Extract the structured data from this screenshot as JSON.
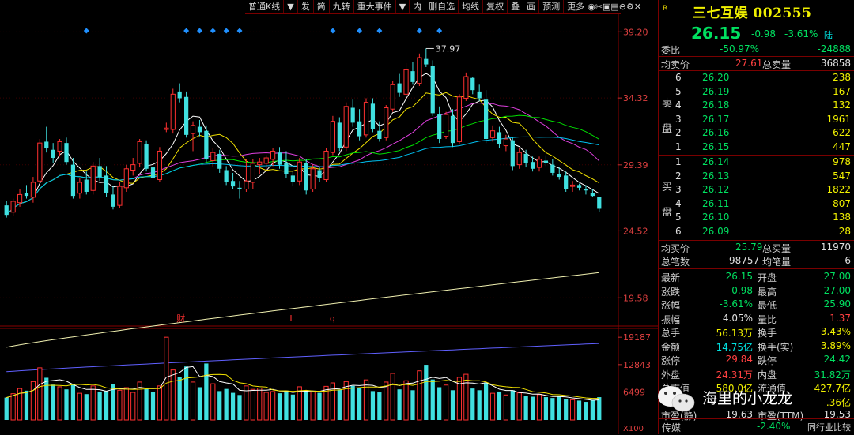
{
  "toolbar": {
    "items": [
      "普通K线",
      "▼",
      "发",
      "简",
      "九转",
      "重大事件",
      "▼",
      "内",
      "删自选",
      "均线",
      "复权",
      "叠",
      "画",
      "预测",
      "更多"
    ],
    "icons": [
      "eye-icon",
      "scissors-icon",
      "lock-icon",
      "box-icon",
      "zoom-out-icon",
      "settings-icon",
      "close-icon"
    ]
  },
  "main_axis": {
    "ticks": [
      "39.20",
      "34.32",
      "29.39",
      "24.52",
      "19.58"
    ],
    "peak_label": "37.97",
    "markers": [
      "财",
      "L",
      "q"
    ]
  },
  "volume_axis": {
    "ticks": [
      "19187",
      "12843",
      "6499"
    ],
    "unit": "X100"
  },
  "stock": {
    "marker": "R",
    "name": "三七互娱",
    "code": "002555",
    "price": "26.15",
    "change": "-0.98",
    "change_pct": "-3.61%",
    "board": "陆"
  },
  "quote": {
    "weibi_label": "委比",
    "weibi": "-50.97%",
    "weicha": "-24888",
    "avg_sell_label": "均卖价",
    "avg_sell": "27.61",
    "total_sell_label": "总卖量",
    "total_sell": "36858",
    "avg_buy_label": "均买价",
    "avg_buy": "25.79",
    "total_buy_label": "总买量",
    "total_buy": "11970",
    "total_trades_label": "总笔数",
    "total_trades": "98757",
    "avg_trade_label": "均笔量",
    "avg_trade": "6"
  },
  "sell_side_label": [
    "卖",
    "盘"
  ],
  "buy_side_label": [
    "买",
    "盘"
  ],
  "asks": [
    {
      "level": "6",
      "price": "26.20",
      "vol": "238"
    },
    {
      "level": "5",
      "price": "26.19",
      "vol": "167"
    },
    {
      "level": "4",
      "price": "26.18",
      "vol": "132"
    },
    {
      "level": "3",
      "price": "26.17",
      "vol": "1961"
    },
    {
      "level": "2",
      "price": "26.16",
      "vol": "622"
    },
    {
      "level": "1",
      "price": "26.15",
      "vol": "447"
    }
  ],
  "bids": [
    {
      "level": "1",
      "price": "26.14",
      "vol": "978"
    },
    {
      "level": "2",
      "price": "26.13",
      "vol": "547"
    },
    {
      "level": "3",
      "price": "26.12",
      "vol": "1822"
    },
    {
      "level": "4",
      "price": "26.11",
      "vol": "807"
    },
    {
      "level": "5",
      "price": "26.10",
      "vol": "138"
    },
    {
      "level": "6",
      "price": "26.09",
      "vol": "28"
    }
  ],
  "stats": [
    {
      "l1": "最新",
      "v1": "26.15",
      "c1": "grn",
      "l2": "开盘",
      "v2": "27.00",
      "c2": "grn"
    },
    {
      "l1": "涨跌",
      "v1": "-0.98",
      "c1": "grn",
      "l2": "最高",
      "v2": "27.00",
      "c2": "grn"
    },
    {
      "l1": "涨幅",
      "v1": "-3.61%",
      "c1": "grn",
      "l2": "最低",
      "v2": "25.90",
      "c2": "grn"
    },
    {
      "l1": "振幅",
      "v1": "4.05%",
      "c1": "wht",
      "l2": "量比",
      "v2": "1.37",
      "c2": "red"
    },
    {
      "l1": "总手",
      "v1": "56.13万",
      "c1": "yel",
      "l2": "换手",
      "v2": "3.43%",
      "c2": "yel"
    },
    {
      "l1": "金额",
      "v1": "14.75亿",
      "c1": "cyan",
      "l2": "换手(实)",
      "v2": "3.89%",
      "c2": "yel"
    },
    {
      "l1": "涨停",
      "v1": "29.84",
      "c1": "red",
      "l2": "跌停",
      "v2": "24.42",
      "c2": "grn"
    },
    {
      "l1": "外盘",
      "v1": "24.31万",
      "c1": "red",
      "l2": "内盘",
      "v2": "31.82万",
      "c2": "grn"
    },
    {
      "l1": "总市值",
      "v1": "580.0亿",
      "c1": "yel",
      "l2": "流通值",
      "v2": "427.7亿",
      "c2": "yel"
    },
    {
      "l1": "",
      "v1": "",
      "c1": "yel",
      "l2": "",
      "v2": ".36亿",
      "c2": "yel"
    },
    {
      "l1": "市盈(静)",
      "v1": "19.63",
      "c1": "wht",
      "l2": "市盈(TTM)",
      "v2": "19.53",
      "c2": "wht"
    }
  ],
  "bottom": {
    "sector": "传媒",
    "sector_pct": "-2.40%",
    "compare": "同行业比较"
  },
  "watermark": {
    "text": "海里的小龙龙"
  },
  "chart_data": {
    "type": "candlestick",
    "title": "",
    "ylim": [
      17.5,
      40.5
    ],
    "ma_colors": [
      "#ffffff",
      "#f0e000",
      "#e040e0",
      "#00e000",
      "#00c0f0",
      "#f0f0b0",
      "#6060ff"
    ],
    "candles": [
      {
        "o": 26.4,
        "h": 26.7,
        "l": 25.5,
        "c": 25.7
      },
      {
        "o": 25.9,
        "h": 26.9,
        "l": 25.6,
        "c": 26.7
      },
      {
        "o": 26.6,
        "h": 27.6,
        "l": 26.3,
        "c": 27.2
      },
      {
        "o": 27.3,
        "h": 27.9,
        "l": 26.9,
        "c": 27.1
      },
      {
        "o": 27.0,
        "h": 28.5,
        "l": 26.6,
        "c": 28.1
      },
      {
        "o": 28.2,
        "h": 31.3,
        "l": 28.0,
        "c": 31.0
      },
      {
        "o": 31.1,
        "h": 32.2,
        "l": 30.3,
        "c": 30.6
      },
      {
        "o": 30.5,
        "h": 31.0,
        "l": 29.5,
        "c": 29.9
      },
      {
        "o": 30.4,
        "h": 31.3,
        "l": 30.0,
        "c": 31.1
      },
      {
        "o": 31.0,
        "h": 31.4,
        "l": 29.4,
        "c": 29.6
      },
      {
        "o": 29.4,
        "h": 29.9,
        "l": 26.9,
        "c": 27.1
      },
      {
        "o": 27.3,
        "h": 28.4,
        "l": 26.9,
        "c": 28.1
      },
      {
        "o": 28.3,
        "h": 28.9,
        "l": 27.2,
        "c": 27.4
      },
      {
        "o": 27.5,
        "h": 29.6,
        "l": 27.2,
        "c": 29.3
      },
      {
        "o": 29.3,
        "h": 29.9,
        "l": 28.2,
        "c": 28.5
      },
      {
        "o": 28.6,
        "h": 29.3,
        "l": 27.0,
        "c": 27.3
      },
      {
        "o": 27.2,
        "h": 27.8,
        "l": 26.1,
        "c": 26.3
      },
      {
        "o": 26.4,
        "h": 28.1,
        "l": 26.2,
        "c": 27.8
      },
      {
        "o": 27.7,
        "h": 29.4,
        "l": 27.4,
        "c": 29.1
      },
      {
        "o": 29.0,
        "h": 29.9,
        "l": 28.6,
        "c": 29.4
      },
      {
        "o": 29.5,
        "h": 31.3,
        "l": 29.2,
        "c": 31.1
      },
      {
        "o": 30.9,
        "h": 31.2,
        "l": 28.9,
        "c": 29.1
      },
      {
        "o": 29.2,
        "h": 29.7,
        "l": 28.1,
        "c": 28.4
      },
      {
        "o": 28.3,
        "h": 30.7,
        "l": 28.1,
        "c": 30.4
      },
      {
        "o": 32.0,
        "h": 32.5,
        "l": 31.8,
        "c": 32.1
      },
      {
        "o": 32.0,
        "h": 35.0,
        "l": 31.7,
        "c": 34.6
      },
      {
        "o": 34.8,
        "h": 35.4,
        "l": 34.0,
        "c": 34.3
      },
      {
        "o": 34.4,
        "h": 34.8,
        "l": 31.4,
        "c": 31.6
      },
      {
        "o": 31.7,
        "h": 32.6,
        "l": 30.4,
        "c": 32.3
      },
      {
        "o": 32.2,
        "h": 32.7,
        "l": 31.5,
        "c": 31.8
      },
      {
        "o": 31.9,
        "h": 32.3,
        "l": 29.6,
        "c": 29.8
      },
      {
        "o": 29.7,
        "h": 30.6,
        "l": 29.2,
        "c": 30.3
      },
      {
        "o": 30.2,
        "h": 30.5,
        "l": 28.8,
        "c": 29.1
      },
      {
        "o": 29.0,
        "h": 29.3,
        "l": 27.9,
        "c": 28.1
      },
      {
        "o": 28.2,
        "h": 28.8,
        "l": 27.6,
        "c": 27.8
      },
      {
        "o": 27.7,
        "h": 28.2,
        "l": 26.9,
        "c": 27.6
      },
      {
        "o": 27.6,
        "h": 29.8,
        "l": 27.4,
        "c": 28.2
      },
      {
        "o": 28.1,
        "h": 29.8,
        "l": 27.6,
        "c": 29.5
      },
      {
        "o": 29.4,
        "h": 29.9,
        "l": 28.7,
        "c": 29.6
      },
      {
        "o": 29.5,
        "h": 30.1,
        "l": 29.0,
        "c": 29.9
      },
      {
        "o": 29.8,
        "h": 30.6,
        "l": 29.3,
        "c": 30.4
      },
      {
        "o": 30.3,
        "h": 30.7,
        "l": 29.1,
        "c": 29.4
      },
      {
        "o": 29.5,
        "h": 30.4,
        "l": 28.4,
        "c": 28.7
      },
      {
        "o": 28.6,
        "h": 28.9,
        "l": 27.8,
        "c": 28.1
      },
      {
        "o": 28.2,
        "h": 29.9,
        "l": 27.9,
        "c": 29.6
      },
      {
        "o": 29.5,
        "h": 29.8,
        "l": 27.2,
        "c": 27.5
      },
      {
        "o": 27.6,
        "h": 29.4,
        "l": 27.4,
        "c": 29.1
      },
      {
        "o": 29.0,
        "h": 29.2,
        "l": 28.1,
        "c": 28.4
      },
      {
        "o": 28.3,
        "h": 30.6,
        "l": 28.1,
        "c": 30.4
      },
      {
        "o": 30.3,
        "h": 33.0,
        "l": 30.1,
        "c": 32.6
      },
      {
        "o": 32.5,
        "h": 32.9,
        "l": 30.4,
        "c": 30.6
      },
      {
        "o": 30.7,
        "h": 34.0,
        "l": 30.4,
        "c": 33.7
      },
      {
        "o": 33.6,
        "h": 34.2,
        "l": 32.2,
        "c": 32.5
      },
      {
        "o": 32.6,
        "h": 33.5,
        "l": 31.2,
        "c": 31.5
      },
      {
        "o": 31.6,
        "h": 34.3,
        "l": 31.4,
        "c": 34.0
      },
      {
        "o": 33.9,
        "h": 34.3,
        "l": 31.8,
        "c": 32.0
      },
      {
        "o": 31.9,
        "h": 32.6,
        "l": 31.1,
        "c": 31.3
      },
      {
        "o": 31.4,
        "h": 33.8,
        "l": 31.2,
        "c": 33.6
      },
      {
        "o": 33.5,
        "h": 35.6,
        "l": 33.3,
        "c": 35.3
      },
      {
        "o": 35.4,
        "h": 36.1,
        "l": 34.4,
        "c": 34.7
      },
      {
        "o": 34.6,
        "h": 36.9,
        "l": 34.3,
        "c": 36.4
      },
      {
        "o": 36.3,
        "h": 37.0,
        "l": 35.3,
        "c": 35.5
      },
      {
        "o": 35.4,
        "h": 37.6,
        "l": 35.2,
        "c": 37.3
      },
      {
        "o": 37.2,
        "h": 37.97,
        "l": 36.6,
        "c": 36.8
      },
      {
        "o": 36.7,
        "h": 37.1,
        "l": 33.0,
        "c": 33.2
      },
      {
        "o": 33.1,
        "h": 33.7,
        "l": 31.0,
        "c": 31.3
      },
      {
        "o": 31.5,
        "h": 33.3,
        "l": 31.3,
        "c": 33.1
      },
      {
        "o": 33.0,
        "h": 33.5,
        "l": 30.7,
        "c": 31.0
      },
      {
        "o": 31.1,
        "h": 34.6,
        "l": 30.9,
        "c": 34.4
      },
      {
        "o": 34.3,
        "h": 36.2,
        "l": 34.1,
        "c": 35.9
      },
      {
        "o": 35.8,
        "h": 35.9,
        "l": 34.6,
        "c": 34.9
      },
      {
        "o": 34.8,
        "h": 35.3,
        "l": 34.1,
        "c": 34.3
      },
      {
        "o": 34.2,
        "h": 34.9,
        "l": 31.0,
        "c": 31.3
      },
      {
        "o": 31.4,
        "h": 32.3,
        "l": 31.1,
        "c": 31.9
      },
      {
        "o": 31.8,
        "h": 32.2,
        "l": 30.6,
        "c": 30.9
      },
      {
        "o": 30.8,
        "h": 31.6,
        "l": 30.4,
        "c": 31.3
      },
      {
        "o": 31.2,
        "h": 31.4,
        "l": 29.0,
        "c": 29.3
      },
      {
        "o": 29.4,
        "h": 30.6,
        "l": 29.1,
        "c": 30.3
      },
      {
        "o": 30.2,
        "h": 30.5,
        "l": 29.2,
        "c": 29.5
      },
      {
        "o": 29.6,
        "h": 30.0,
        "l": 28.9,
        "c": 29.1
      },
      {
        "o": 29.2,
        "h": 30.0,
        "l": 28.9,
        "c": 29.8
      },
      {
        "o": 29.7,
        "h": 30.1,
        "l": 29.3,
        "c": 29.5
      },
      {
        "o": 29.4,
        "h": 29.8,
        "l": 28.6,
        "c": 28.8
      },
      {
        "o": 28.7,
        "h": 29.2,
        "l": 28.3,
        "c": 28.5
      },
      {
        "o": 28.6,
        "h": 28.9,
        "l": 27.4,
        "c": 27.6
      },
      {
        "o": 27.8,
        "h": 28.2,
        "l": 27.4,
        "c": 27.9
      },
      {
        "o": 27.9,
        "h": 28.0,
        "l": 27.5,
        "c": 27.7
      },
      {
        "o": 27.6,
        "h": 27.9,
        "l": 27.2,
        "c": 27.5
      },
      {
        "o": 27.3,
        "h": 27.6,
        "l": 27.0,
        "c": 27.1
      },
      {
        "o": 27.0,
        "h": 27.0,
        "l": 25.9,
        "c": 26.15
      }
    ],
    "volumes": [
      5200,
      6100,
      7300,
      6800,
      8900,
      12100,
      9800,
      8200,
      7700,
      7100,
      8400,
      6200,
      6000,
      7900,
      6600,
      6700,
      8300,
      6900,
      7500,
      6400,
      8800,
      7200,
      6500,
      7900,
      19187,
      11600,
      9900,
      12400,
      8800,
      7600,
      13100,
      8400,
      6700,
      7200,
      6300,
      5800,
      7900,
      7100,
      7400,
      6400,
      6600,
      6200,
      6800,
      5900,
      7700,
      6800,
      6500,
      6300,
      7800,
      8600,
      7100,
      8900,
      7900,
      7400,
      9300,
      6700,
      6400,
      8800,
      10800,
      7100,
      9100,
      6900,
      11400,
      12800,
      9400,
      7600,
      8100,
      6900,
      9900,
      10600,
      7300,
      6900,
      8700,
      6200,
      6600,
      5800,
      6900,
      6300,
      5600,
      5400,
      5900,
      5300,
      5100,
      5600,
      4900,
      4700,
      4500,
      4200,
      4600,
      5300
    ]
  }
}
